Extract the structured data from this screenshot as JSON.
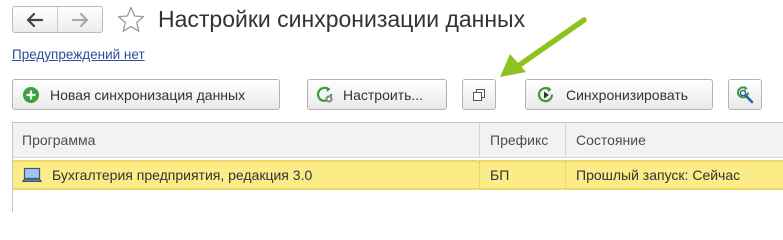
{
  "window": {
    "title": "Настройки синхронизации данных"
  },
  "nav": {
    "back_icon": "arrow-left-icon",
    "forward_icon": "arrow-right-icon",
    "favorite_icon": "star-outline-icon"
  },
  "warnings_link": "Предупреждений нет",
  "toolbar": {
    "new_sync_label": "Новая синхронизация данных",
    "new_sync_icon": "plus-circle-icon",
    "settings_label": "Настроить...",
    "settings_icon": "refresh-gear-icon",
    "window_icon": "open-window-icon",
    "sync_label": "Синхронизировать",
    "sync_icon": "sync-play-icon",
    "find_icon": "search-refresh-icon"
  },
  "annotation": {
    "arrow_color": "#8dc21f"
  },
  "table": {
    "columns": [
      "Программа",
      "Префикс",
      "Состояние"
    ],
    "rows": [
      {
        "program": "Бухгалтерия предприятия, редакция 3.0",
        "prefix": "БП",
        "state": "Прошлый запуск: Сейчас",
        "icon": "computer-icon",
        "selected": true
      }
    ]
  },
  "colors": {
    "selected_row": "#fbec88",
    "link": "#2c4f9a",
    "accent_green": "#3aa040"
  }
}
